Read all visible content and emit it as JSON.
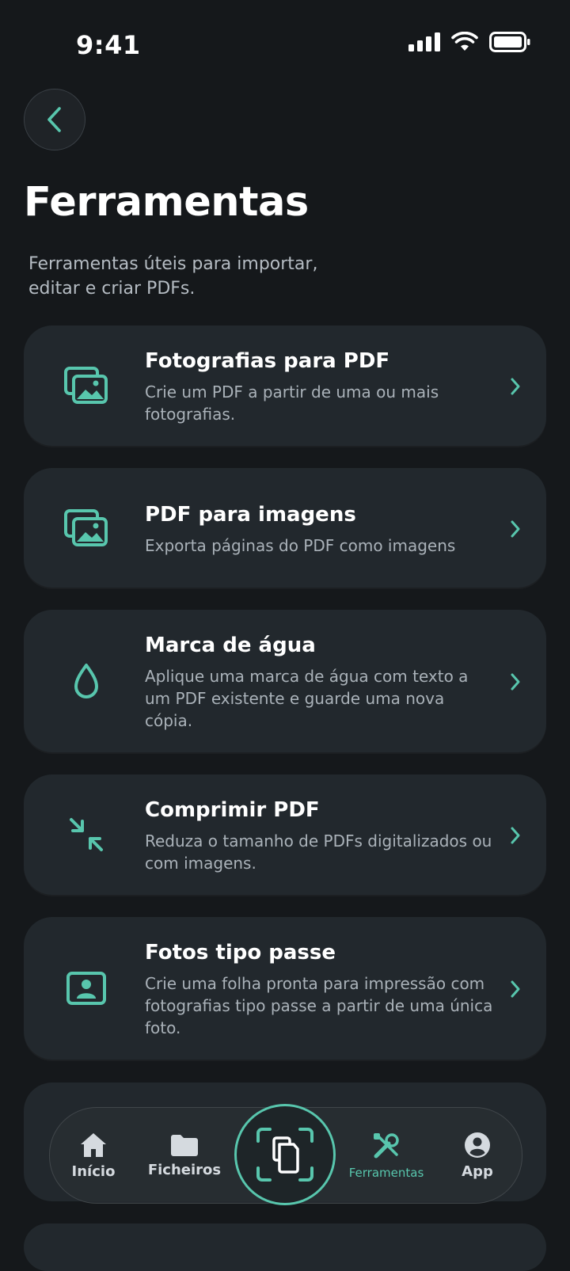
{
  "status": {
    "time": "9:41"
  },
  "header": {
    "title": "Ferramentas",
    "subtitle": "Ferramentas úteis para importar, editar e criar PDFs."
  },
  "tools": [
    {
      "title": "Fotografias para PDF",
      "desc": "Crie um PDF a partir de uma ou mais fotografias.",
      "icon": "photos-icon"
    },
    {
      "title": "PDF para imagens",
      "desc": "Exporta páginas do PDF como imagens",
      "icon": "images-icon"
    },
    {
      "title": "Marca de água",
      "desc": "Aplique uma marca de água com texto a um PDF existente e guarde uma nova cópia.",
      "icon": "water-drop-icon"
    },
    {
      "title": "Comprimir PDF",
      "desc": "Reduza o tamanho de PDFs digitalizados ou com imagens.",
      "icon": "compress-icon"
    },
    {
      "title": "Fotos tipo passe",
      "desc": "Crie uma folha pronta para impressão com fotografias tipo passe a partir de uma única foto.",
      "icon": "portrait-icon"
    }
  ],
  "nav": {
    "items": [
      {
        "label": "Início",
        "icon": "home-icon"
      },
      {
        "label": "Ficheiros",
        "icon": "folder-icon"
      },
      {
        "label": "Ferramentas",
        "icon": "tools-icon",
        "active": true
      },
      {
        "label": "App",
        "icon": "account-icon"
      }
    ],
    "scan_icon": "scan-document-icon"
  },
  "colors": {
    "accent": "#58c6ad",
    "background": "#15181b",
    "card": "#22282d"
  }
}
